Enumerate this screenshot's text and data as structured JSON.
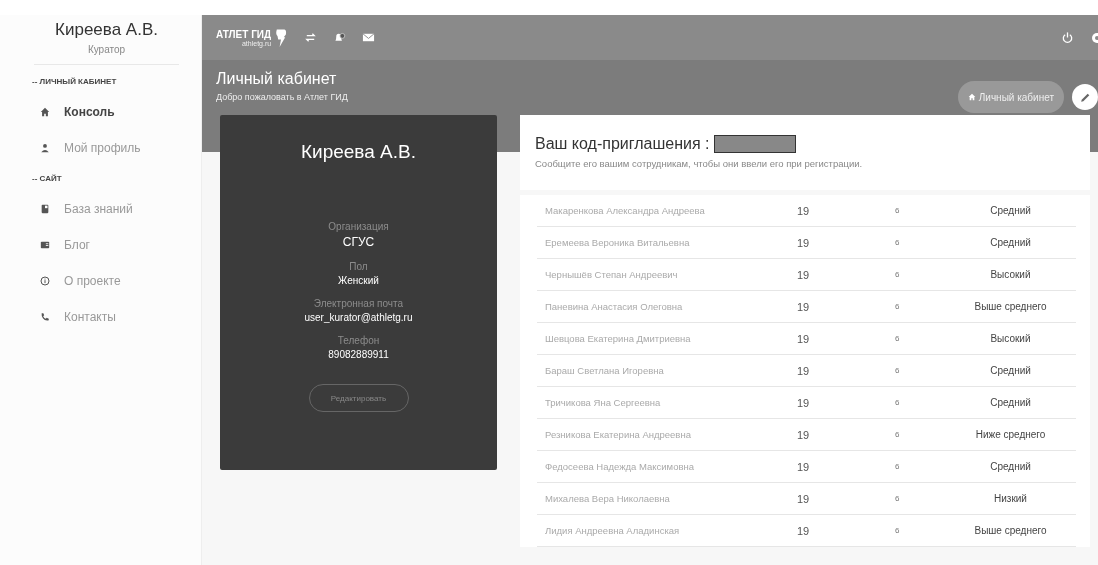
{
  "sidebar": {
    "user_name": "Киреева А.В.",
    "user_role": "Куратор",
    "sections": [
      {
        "title": "-- ЛИЧНЫЙ КАБИНЕТ",
        "items": [
          {
            "label": "Консоль",
            "kind": "home",
            "selected": true
          },
          {
            "label": "Мой профиль",
            "kind": "user",
            "selected": false
          }
        ]
      },
      {
        "title": "-- САЙТ",
        "items": [
          {
            "label": "База знаний",
            "kind": "book",
            "selected": false
          },
          {
            "label": "Блог",
            "kind": "card",
            "selected": false
          },
          {
            "label": "О проекте",
            "kind": "info",
            "selected": false
          },
          {
            "label": "Контакты",
            "kind": "phone",
            "selected": false
          }
        ]
      }
    ]
  },
  "topbar": {
    "logo_text": "АТЛЕТ ГИД",
    "logo_subtext": "athletg.ru"
  },
  "header": {
    "title": "Личный кабинет",
    "subtitle": "Добро пожаловать в Атлет ГИД",
    "breadcrumb": "Личный кабинет"
  },
  "profile_card": {
    "name": "Киреева А.В.",
    "fields": [
      {
        "label": "Организация",
        "value": "СГУС"
      },
      {
        "label": "Пол",
        "value": "Женский"
      },
      {
        "label": "Электронная почта",
        "value": "user_kurator@athletg.ru"
      },
      {
        "label": "Телефон",
        "value": "89082889911"
      }
    ],
    "button": "Редактировать"
  },
  "invite": {
    "title": "Ваш код-приглашения :",
    "hint": "Сообщите его вашим сотрудникам, чтобы они ввели его при регистрации."
  },
  "table": {
    "rows": [
      {
        "name": "Макаренкова Александра Андреева",
        "column_2": "19",
        "column_3": "6",
        "column_4": "Средний"
      },
      {
        "name": "Еремеева Вероника Витальевна",
        "column_2": "19",
        "column_3": "6",
        "column_4": "Средний"
      },
      {
        "name": "Чернышёв Степан Андреевич",
        "column_2": "19",
        "column_3": "6",
        "column_4": "Высокий"
      },
      {
        "name": "Паневина Анастасия Олеговна",
        "column_2": "19",
        "column_3": "6",
        "column_4": "Выше среднего"
      },
      {
        "name": "Шевцова Екатерина Дмитриевна",
        "column_2": "19",
        "column_3": "6",
        "column_4": "Высокий"
      },
      {
        "name": "Бараш Светлана Игоревна",
        "column_2": "19",
        "column_3": "6",
        "column_4": "Средний"
      },
      {
        "name": "Тричикова Яна Сергеевна",
        "column_2": "19",
        "column_3": "6",
        "column_4": "Средний"
      },
      {
        "name": "Резникова Екатерина Андреевна",
        "column_2": "19",
        "column_3": "6",
        "column_4": "Ниже среднего"
      },
      {
        "name": "Федосеева Надежда Максимовна",
        "column_2": "19",
        "column_3": "6",
        "column_4": "Средний"
      },
      {
        "name": "Михалева Вера Николаевна",
        "column_2": "19",
        "column_3": "6",
        "column_4": "Низкий"
      },
      {
        "name": "Лидия Андреевна Аладинская",
        "column_2": "19",
        "column_3": "6",
        "column_4": "Выше среднего"
      }
    ]
  }
}
